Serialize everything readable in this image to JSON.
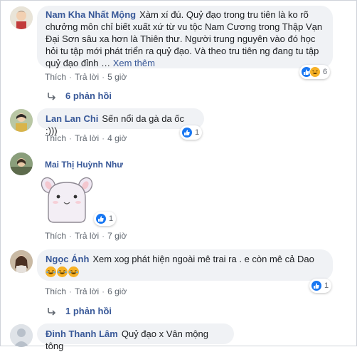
{
  "comments": [
    {
      "author": "Nam Kha Nhất Mộng",
      "text_lines": [
        "Xàm xí đú. Quỷ đạo trong tru tiên là ko rõ",
        "chưởng môn chỉ biết xuất xứ từ vu tộc Nam Cương trong Thập Vạn",
        "Đại Sơn sâu xa hơn là Thiên thư. Người trung nguyên vào đó học",
        "hỏi tu tập mới phát triển ra quỷ đạo. Và theo tru tiên ng đang tu tập",
        "quỷ đạo đỉnh …"
      ],
      "see_more": "Xem thêm",
      "like": "Thích",
      "reply": "Trả lời",
      "time": "5 giờ",
      "reaction_count": "6",
      "replies_label": "6 phản hồi"
    },
    {
      "author": "Lan Lan Chi",
      "text": "Sến nổi da gà da ốc :)))",
      "like": "Thích",
      "reply": "Trả lời",
      "time": "4 giờ",
      "reaction_count": "1"
    },
    {
      "author": "Mai Thị Huỳnh Như",
      "like": "Thích",
      "reply": "Trả lời",
      "time": "7 giờ",
      "reaction_count": "1"
    },
    {
      "author": "Ngọc Ánh",
      "text": "Xem xog phát hiện ngoài mê trai ra . e còn mê cả Dao",
      "like": "Thích",
      "reply": "Trả lời",
      "time": "6 giờ",
      "reaction_count": "1",
      "replies_label": "1 phản hồi"
    },
    {
      "author": "Đinh Thanh Lâm",
      "text": "Quỷ đạo x Vân mộng tông"
    }
  ],
  "colors": {
    "author": "#385898",
    "bubble": "#f0f2f5",
    "meta": "#606770",
    "like_blue": "#1877f2",
    "haha_yellow": "#f7b125"
  },
  "icons": [
    "reply-arrow-icon",
    "like-reaction-icon",
    "haha-reaction-icon",
    "sticker-bunny"
  ]
}
